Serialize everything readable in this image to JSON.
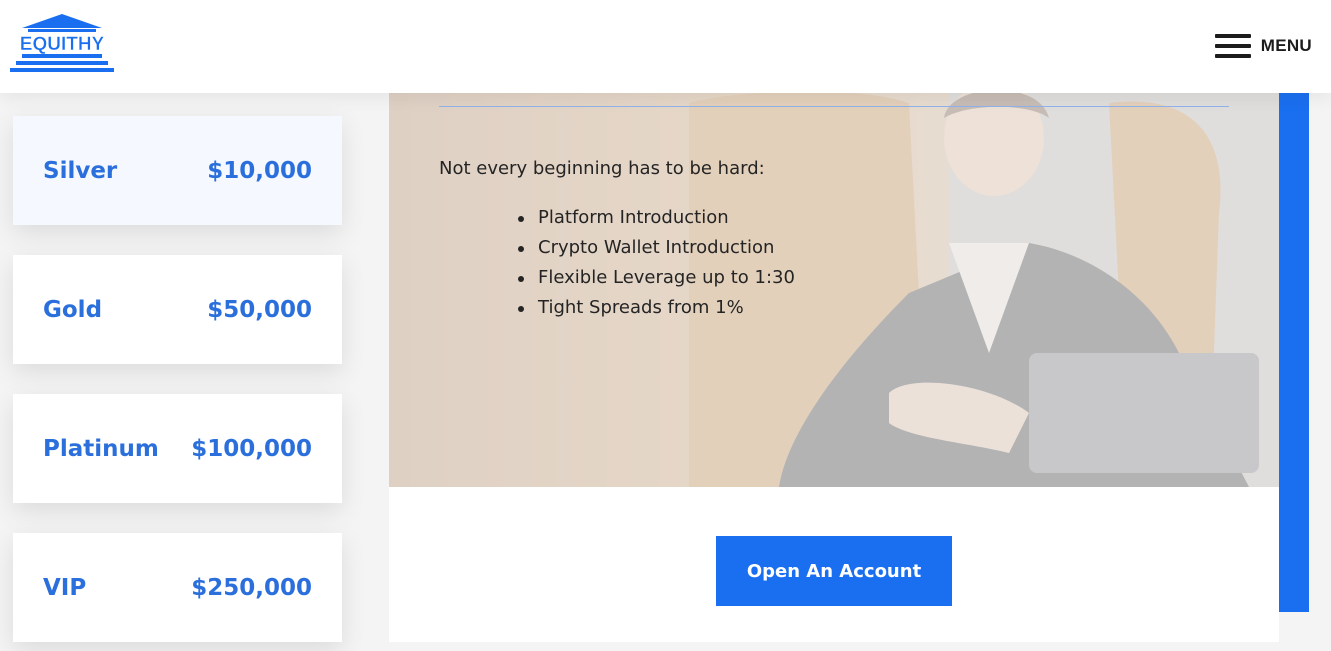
{
  "header": {
    "logo_text": "EQUITHY",
    "menu_label": "MENU"
  },
  "plans": [
    {
      "name": "Silver",
      "price": "$10,000"
    },
    {
      "name": "Gold",
      "price": "$50,000"
    },
    {
      "name": "Platinum",
      "price": "$100,000"
    },
    {
      "name": "VIP",
      "price": "$250,000"
    }
  ],
  "content": {
    "intro": "Not every beginning has to be hard:",
    "features": [
      "Platform Introduction",
      "Crypto Wallet Introduction",
      "Flexible Leverage up to 1:30",
      "Tight Spreads from 1%"
    ],
    "cta_label": "Open An Account"
  },
  "colors": {
    "accent": "#1a6ff0",
    "plan_text": "#2a6fdb"
  }
}
